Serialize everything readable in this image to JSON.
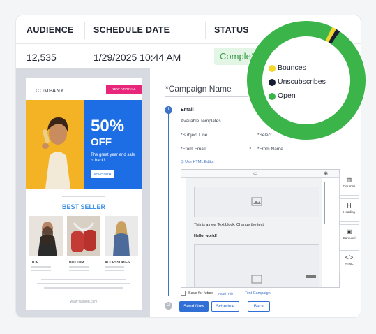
{
  "table": {
    "headers": {
      "audience": "AUDIENCE",
      "schedule": "SCHEDULE DATE",
      "status": "STATUS"
    },
    "row": {
      "audience": "12,535",
      "schedule": "1/29/2025 10:44 AM",
      "status": "Complete"
    }
  },
  "email_preview": {
    "company": "COMPANY",
    "badge": "NEW ARRIVAL",
    "hero_percent": "50%",
    "hero_off": "OFF",
    "hero_tagline": "The great year end sale is back!",
    "shop_button": "SHOP NOW",
    "section_title": "BEST SELLER",
    "products": [
      "TOP",
      "BOTTOM",
      "ACCESSORIES"
    ],
    "footer_url": "www.fashion.com"
  },
  "form": {
    "campaign_name_placeholder": "*Campaign Name",
    "step1_number": "1",
    "step2_number": "2",
    "email_label": "Email",
    "available_templates": "Available Templates",
    "subject_line": "*Subject Line",
    "select_field": "*Select",
    "from_email": "*From Email",
    "from_name": "*From Name",
    "html_editor_link": "Use HTML Editor",
    "editor_text": "This is a new Text block. Change the text.",
    "editor_hello": "Hello, world!",
    "save_future": "Save for future",
    "attach_file": "Attach File",
    "test_campaign": "Test Campaign",
    "buttons": {
      "send": "Send Now",
      "schedule": "Schedule",
      "back": "Back"
    },
    "tools": [
      {
        "icon": "columns-icon",
        "label": "Columns"
      },
      {
        "icon": "heading-icon",
        "label": "Heading"
      },
      {
        "icon": "carousel-icon",
        "label": "Carousel"
      },
      {
        "icon": "html-icon",
        "label": "HTML"
      }
    ]
  },
  "donut": {
    "legend": [
      {
        "label": "Bounces",
        "color": "#f5d72a",
        "fraction": 0.012
      },
      {
        "label": "Unscubscribes",
        "color": "#141d33",
        "fraction": 0.012
      },
      {
        "label": "Open",
        "color": "#3bb54a",
        "fraction": 0.976
      }
    ]
  }
}
